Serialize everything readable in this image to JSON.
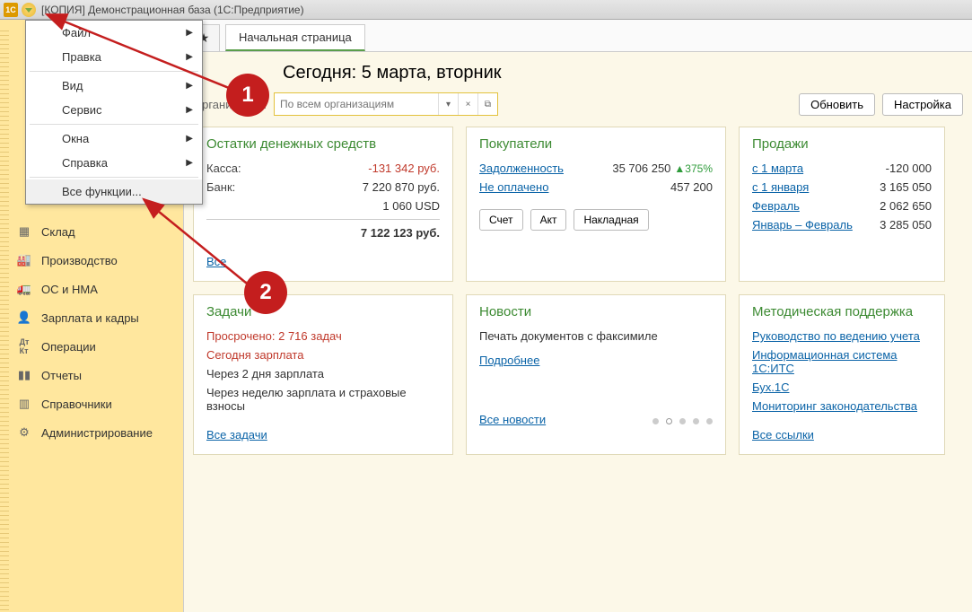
{
  "window_title": "[КОПИЯ] Демонстрационная база  (1С:Предприятие)",
  "dropdown": {
    "items": [
      {
        "label": "Файл",
        "arrow": true
      },
      {
        "label": "Правка",
        "arrow": true
      },
      {
        "label": "Вид",
        "arrow": true
      },
      {
        "label": "Сервис",
        "arrow": true
      },
      {
        "label": "Окна",
        "arrow": true
      },
      {
        "label": "Справка",
        "arrow": true
      }
    ],
    "all_functions": "Все функции..."
  },
  "sidebar": {
    "items": [
      "Склад",
      "Производство",
      "ОС и НМА",
      "Зарплата и кадры",
      "Операции",
      "Отчеты",
      "Справочники",
      "Администрирование"
    ]
  },
  "tab": {
    "active": "Начальная страница"
  },
  "header": {
    "today": "Сегодня: 5 марта, вторник",
    "org_placeholder": "По всем организациям",
    "org_label": "Организация:",
    "refresh": "Обновить",
    "settings": "Настройка"
  },
  "balances": {
    "title": "Остатки денежных средств",
    "kassa_label": "Касса:",
    "kassa_value": "-131 342 руб.",
    "bank_label": "Банк:",
    "bank_value": "7 220 870 руб.",
    "usd_value": "1 060 USD",
    "total": "7 122 123 руб.",
    "all": "Все"
  },
  "buyers": {
    "title": "Покупатели",
    "debt": "Задолженность",
    "debt_value": "35 706 250",
    "debt_delta": "▲375%",
    "unpaid": "Не оплачено",
    "unpaid_value": "457 200",
    "btn_schet": "Счет",
    "btn_akt": "Акт",
    "btn_nakl": "Накладная"
  },
  "sales": {
    "title": "Продажи",
    "rows": [
      {
        "label": "с 1 марта",
        "value": "-120 000"
      },
      {
        "label": "с 1 января",
        "value": "3 165 050"
      },
      {
        "label": "Февраль",
        "value": "2 062 650"
      },
      {
        "label": "Январь – Февраль",
        "value": "3 285 050"
      }
    ]
  },
  "tasks": {
    "title": "Задачи",
    "overdue": "Просрочено: 2 716 задач",
    "today_salary": "Сегодня зарплата",
    "in2": "Через 2 дня зарплата",
    "week": "Через неделю зарплата и страховые взносы",
    "all": "Все задачи"
  },
  "news": {
    "title": "Новости",
    "line": "Печать документов с факсимиле",
    "more": "Подробнее",
    "all": "Все новости"
  },
  "method": {
    "title": "Методическая поддержка",
    "l1": "Руководство по ведению учета",
    "l2": "Информационная система 1С:ИТС",
    "l3": "Бух.1С",
    "l4": "Мониторинг законодательства",
    "all": "Все ссылки"
  },
  "anno": {
    "one": "1",
    "two": "2"
  }
}
